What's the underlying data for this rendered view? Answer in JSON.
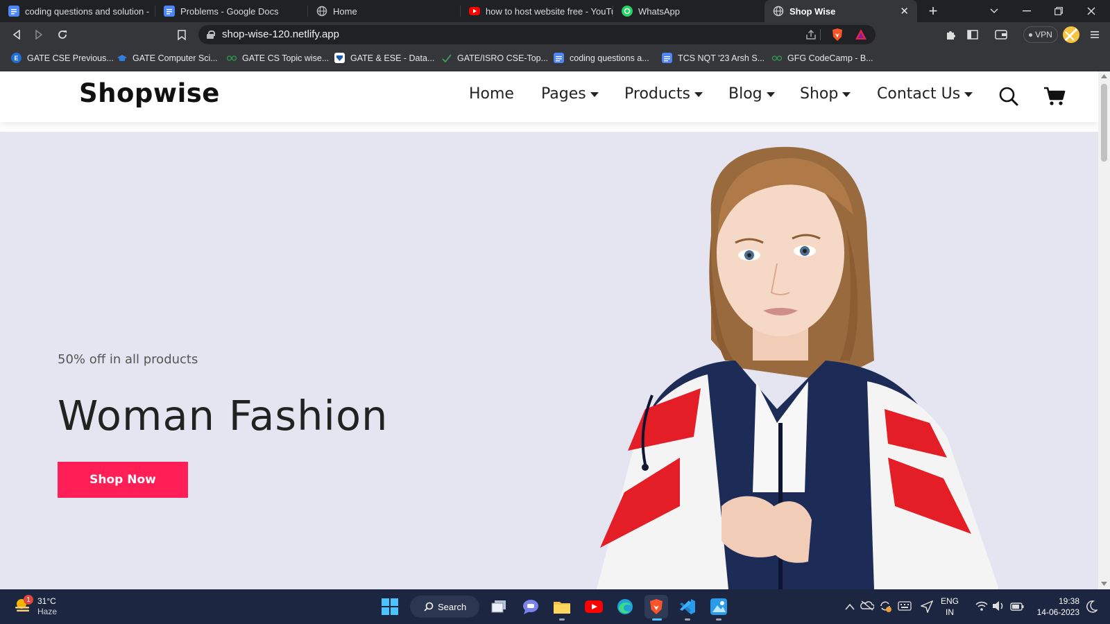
{
  "browser": {
    "tabs": [
      {
        "title": "coding questions and solution -",
        "icon": "google-docs-icon",
        "active": false
      },
      {
        "title": "Problems - Google Docs",
        "icon": "google-docs-icon",
        "active": false
      },
      {
        "title": "Home",
        "icon": "globe-icon",
        "active": false
      },
      {
        "title": "how to host website free - YouTu",
        "icon": "youtube-icon",
        "active": false
      },
      {
        "title": "WhatsApp",
        "icon": "whatsapp-icon",
        "active": false
      },
      {
        "title": "Shop Wise",
        "icon": "globe-icon",
        "active": true
      }
    ],
    "close_tab": "✕",
    "new_tab": "+",
    "url": "shop-wise-120.netlify.app",
    "vpn_label": "VPN",
    "bookmarks": [
      {
        "label": "GATE CSE Previous...",
        "icon": "gate-e-icon"
      },
      {
        "label": "GATE Computer Sci...",
        "icon": "graduation-cap-icon"
      },
      {
        "label": "GATE CS Topic wise...",
        "icon": "gfg-icon"
      },
      {
        "label": "GATE & ESE - Data...",
        "icon": "shield-icon"
      },
      {
        "label": "GATE/ISRO CSE-Top...",
        "icon": "checkmark-icon"
      },
      {
        "label": "coding questions a...",
        "icon": "google-docs-icon"
      },
      {
        "label": "TCS NQT '23 Arsh S...",
        "icon": "google-docs-icon"
      },
      {
        "label": "GFG CodeCamp - B...",
        "icon": "gfg-icon"
      }
    ]
  },
  "site": {
    "logo": "Shopwise",
    "nav": [
      {
        "label": "Home",
        "dropdown": false
      },
      {
        "label": "Pages",
        "dropdown": true
      },
      {
        "label": "Products",
        "dropdown": true
      },
      {
        "label": "Blog",
        "dropdown": true
      },
      {
        "label": "Shop",
        "dropdown": true
      },
      {
        "label": "Contact Us",
        "dropdown": true
      }
    ],
    "hero": {
      "subtitle": "50% off in all products",
      "headline": "Woman Fashion",
      "cta": "Shop Now"
    },
    "accent_color": "#ff1e56"
  },
  "taskbar": {
    "weather_temp": "31°C",
    "weather_desc": "Haze",
    "weather_badge": "1",
    "search_label": "Search",
    "lang_line1": "ENG",
    "lang_line2": "IN",
    "time": "19:38",
    "date": "14-06-2023"
  }
}
